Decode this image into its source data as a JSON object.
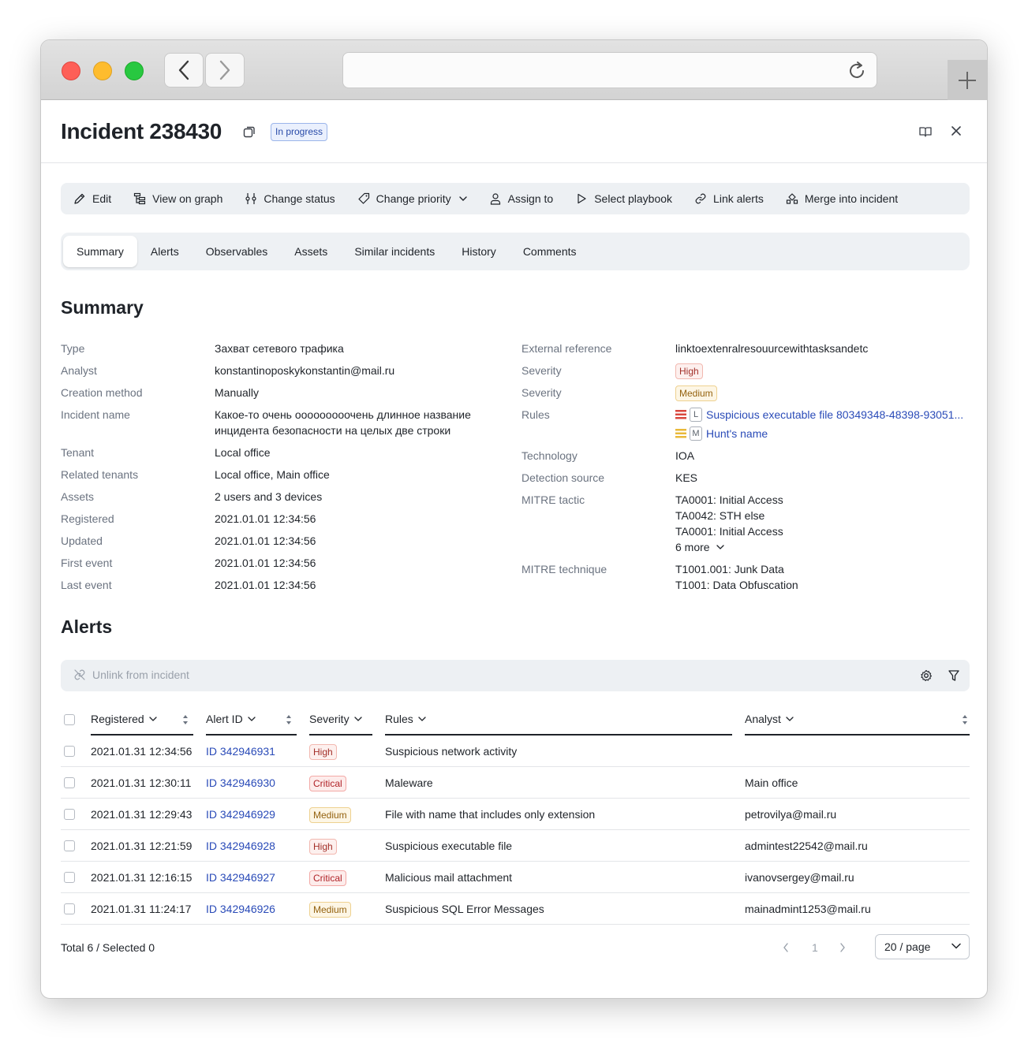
{
  "incident": {
    "title": "Incident 238430",
    "status": "In progress"
  },
  "toolbar": {
    "edit": "Edit",
    "view_on_graph": "View on graph",
    "change_status": "Change status",
    "change_priority": "Change priority",
    "assign_to": "Assign to",
    "select_playbook": "Select playbook",
    "link_alerts": "Link alerts",
    "merge_into_incident": "Merge into incident"
  },
  "tabs": [
    "Summary",
    "Alerts",
    "Observables",
    "Assets",
    "Similar incidents",
    "History",
    "Comments"
  ],
  "summary": {
    "title": "Summary",
    "left": {
      "type": {
        "label": "Type",
        "value": "Захват сетевого трафика"
      },
      "analyst": {
        "label": "Analyst",
        "value": "konstantinoposkykonstantin@mail.ru"
      },
      "creation_method": {
        "label": "Creation method",
        "value": "Manually"
      },
      "incident_name": {
        "label": "Incident name",
        "line1": "Какое-то очень ооооооооочень длинное название",
        "line2": "инцидента безопасности на целых две строки"
      },
      "tenant": {
        "label": "Tenant",
        "value": "Local office"
      },
      "related_tenants": {
        "label": "Related tenants",
        "value": "Local office, Main office"
      },
      "assets": {
        "label": "Assets",
        "value": "2 users and 3 devices"
      },
      "registered": {
        "label": "Registered",
        "value": "2021.01.01 12:34:56"
      },
      "updated": {
        "label": "Updated",
        "value": "2021.01.01 12:34:56"
      },
      "first_event": {
        "label": "First event",
        "value": "2021.01.01 12:34:56"
      },
      "last_event": {
        "label": "Last event",
        "value": "2021.01.01 12:34:56"
      }
    },
    "right": {
      "external_reference": {
        "label": "External reference",
        "value": "linktoextenralresouurcewithtasksandetc"
      },
      "severity1": {
        "label": "Severity",
        "value": "High"
      },
      "severity2": {
        "label": "Severity",
        "value": "Medium"
      },
      "rules": {
        "label": "Rules",
        "items": [
          {
            "letter": "L",
            "name": "Suspicious executable file 80349348-48398-93051...",
            "color": "#d9473d"
          },
          {
            "letter": "M",
            "name": "Hunt's name",
            "color": "#e9b93a"
          }
        ]
      },
      "technology": {
        "label": "Technology",
        "value": "IOA"
      },
      "detection_source": {
        "label": "Detection source",
        "value": "KES"
      },
      "mitre_tactic": {
        "label": "MITRE tactic",
        "items": [
          "TA0001: Initial Access",
          "TA0042: STH else",
          "TA0001: Initial Access"
        ],
        "more": "6 more"
      },
      "mitre_technique": {
        "label": "MITRE technique",
        "items": [
          "T1001.001: Junk Data",
          "T1001: Data Obfuscation"
        ]
      }
    }
  },
  "alerts": {
    "title": "Alerts",
    "unlink": "Unlink from incident",
    "columns": {
      "registered": "Registered",
      "alert_id": "Alert ID",
      "severity": "Severity",
      "rules": "Rules",
      "analyst": "Analyst"
    },
    "rows": [
      {
        "registered": "2021.01.31  12:34:56",
        "id": "ID 342946931",
        "severity": "High",
        "sev_class": "high",
        "rule": "Suspicious network activity",
        "analyst": ""
      },
      {
        "registered": "2021.01.31  12:30:11",
        "id": "ID 342946930",
        "severity": "Critical",
        "sev_class": "critical",
        "rule": "Maleware",
        "analyst": "Main office"
      },
      {
        "registered": "2021.01.31  12:29:43",
        "id": "ID 342946929",
        "severity": "Medium",
        "sev_class": "medium",
        "rule": "File with name that includes only extension",
        "analyst": "petrovilya@mail.ru"
      },
      {
        "registered": "2021.01.31  12:21:59",
        "id": "ID 342946928",
        "severity": "High",
        "sev_class": "high",
        "rule": "Suspicious executable file",
        "analyst": "admintest22542@mail.ru"
      },
      {
        "registered": "2021.01.31  12:16:15",
        "id": "ID 342946927",
        "severity": "Critical",
        "sev_class": "critical",
        "rule": "Malicious mail attachment",
        "analyst": "ivanovsergey@mail.ru"
      },
      {
        "registered": "2021.01.31  11:24:17",
        "id": "ID 342946926",
        "severity": "Medium",
        "sev_class": "medium",
        "rule": "Suspicious SQL Error Messages",
        "analyst": "mainadmint1253@mail.ru"
      }
    ],
    "footer": {
      "total": "Total 6 / Selected 0",
      "page": "1",
      "page_size": "20 / page"
    }
  },
  "colors": {
    "link": "#2a4bb8",
    "status_badge": "#284aa8",
    "high": "#a3302a",
    "medium": "#94620f",
    "critical": "#b02328"
  }
}
